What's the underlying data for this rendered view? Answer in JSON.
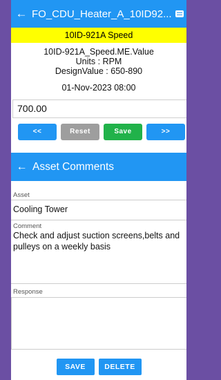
{
  "header": {
    "title": "FO_CDU_Heater_A_10ID92..."
  },
  "tag_banner": "10ID-921A Speed",
  "info": {
    "tag_path": "10ID-921A_Speed.ME.Value",
    "units": "Units : RPM",
    "design_value": "DesignValue : 650-890"
  },
  "datetime": "01-Nov-2023 08:00",
  "value_input": "700.00",
  "nav": {
    "prev": "<<",
    "reset": "Reset",
    "save": "Save",
    "next": ">>"
  },
  "dialog": {
    "title": "Asset Comments",
    "asset_label": "Asset",
    "asset_value": "Cooling Tower",
    "comment_label": "Comment",
    "comment_value": "Check and adjust suction screens,belts and pulleys on a weekly basis",
    "response_label": "Response",
    "response_value": "",
    "save_label": "SAVE",
    "delete_label": "DELETE"
  },
  "colors": {
    "accent": "#2196f3",
    "banner": "#ffff00",
    "save_green": "#21b24a",
    "reset_grey": "#9e9e9e",
    "background": "#6b4fa3"
  },
  "icons": {
    "back": "arrow-left-icon",
    "menu": "message-icon"
  }
}
